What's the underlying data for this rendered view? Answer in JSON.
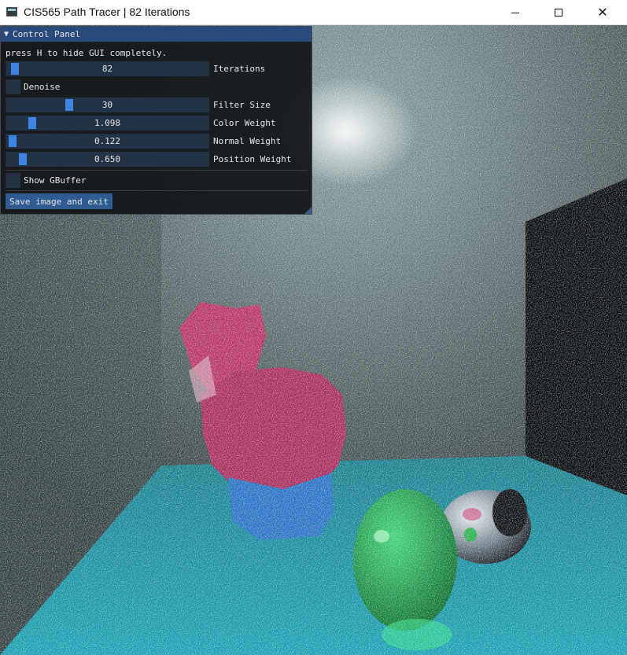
{
  "window": {
    "title": "CIS565 Path Tracer | 82 Iterations",
    "icon": "app-window-icon",
    "controls": {
      "minimize": "minimize-icon",
      "maximize": "maximize-icon",
      "close": "✕"
    }
  },
  "panel": {
    "title": "Control Panel",
    "hint": "press H to hide GUI completely.",
    "sliders": {
      "iterations": {
        "label": "Iterations",
        "value": "82",
        "fraction": 0.02
      },
      "filter_size": {
        "label": "Filter Size",
        "value": "30",
        "fraction": 0.3
      },
      "color_weight": {
        "label": "Color Weight",
        "value": "1.098",
        "fraction": 0.11
      },
      "normal_weight": {
        "label": "Normal Weight",
        "value": "0.122",
        "fraction": 0.01
      },
      "position_weight": {
        "label": "Position Weight",
        "value": "0.650",
        "fraction": 0.06
      }
    },
    "checkboxes": {
      "denoise": {
        "label": "Denoise",
        "checked": false
      },
      "show_gbuffer": {
        "label": "Show GBuffer",
        "checked": false
      }
    },
    "save_button": "Save image and exit"
  },
  "colors": {
    "panel_header": "#2a4a7b",
    "slider_frame": "#223348",
    "slider_grab": "#3d85e0",
    "button": "#2f5a92",
    "floor": "#1fa6b8",
    "bunny": "#c93a6f",
    "green_sphere": "#1fa94a"
  }
}
